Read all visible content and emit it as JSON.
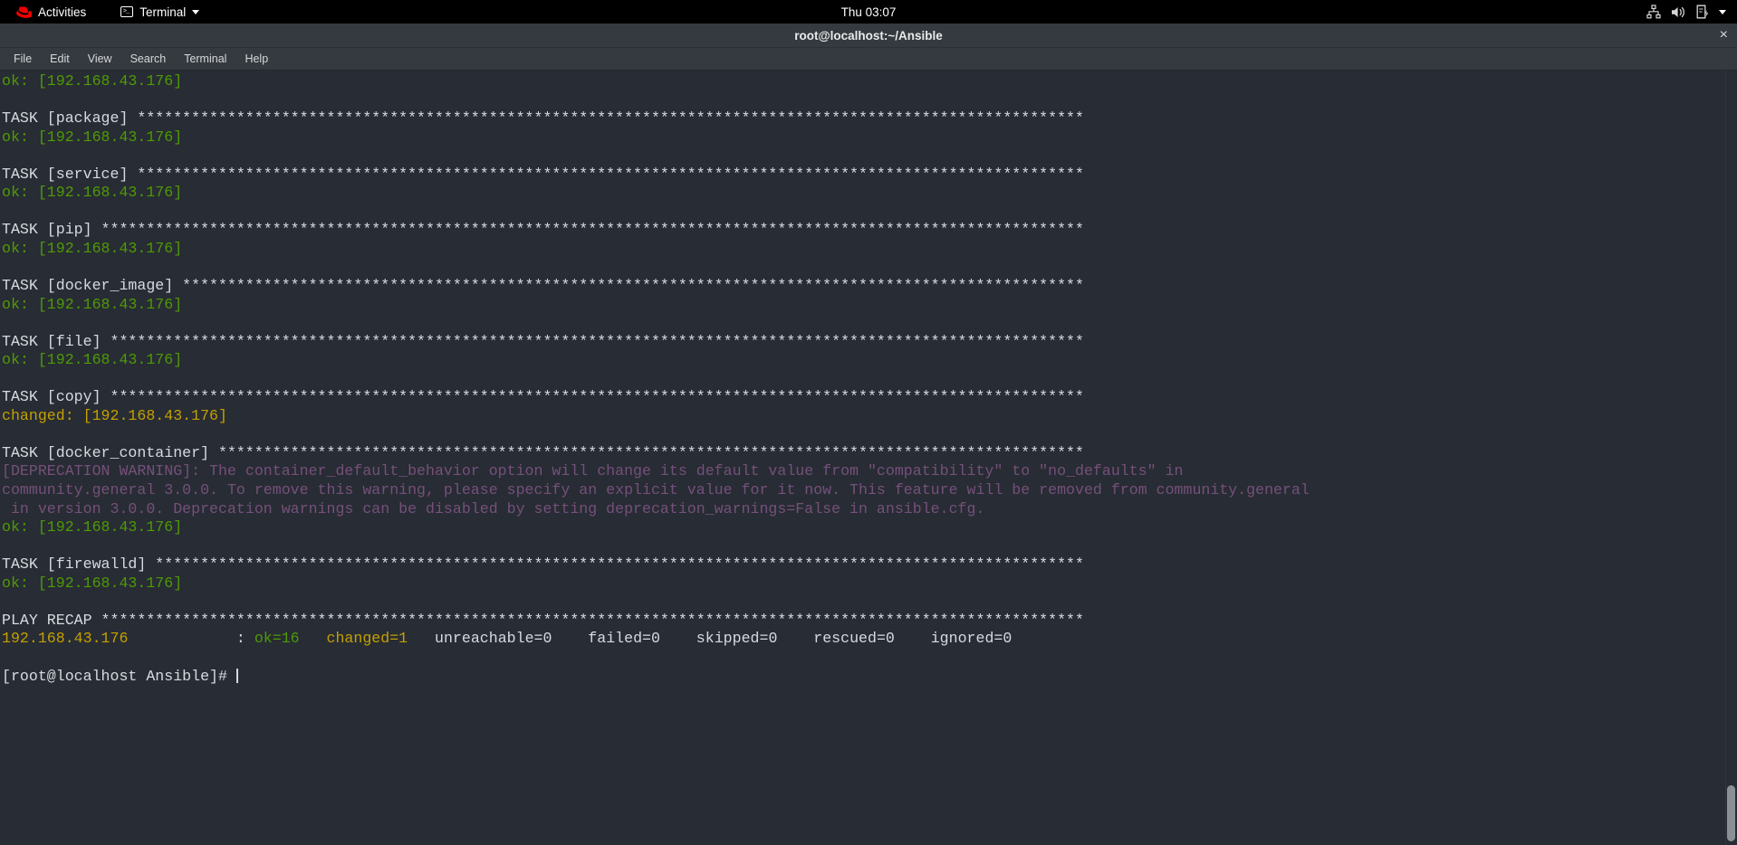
{
  "topbar": {
    "activities_label": "Activities",
    "app_label": "Terminal",
    "clock": "Thu 03:07",
    "icons": {
      "redhat": "redhat-logo-icon",
      "terminal": "terminal-icon",
      "caret": "chevron-down-icon",
      "network": "network-icon",
      "volume": "volume-icon",
      "battery": "battery-charging-icon",
      "system_menu_caret": "chevron-down-icon"
    }
  },
  "window": {
    "title": "root@localhost:~/Ansible",
    "close_glyph": "×"
  },
  "menubar": {
    "items": [
      {
        "label": "File"
      },
      {
        "label": "Edit"
      },
      {
        "label": "View"
      },
      {
        "label": "Search"
      },
      {
        "label": "Terminal"
      },
      {
        "label": "Help"
      }
    ]
  },
  "terminal": {
    "host": "192.168.43.176",
    "prompt": "[root@localhost Ansible]# ",
    "lines": [
      {
        "text": "ok: [192.168.43.176]",
        "color": "green"
      },
      {
        "text": "",
        "color": "white"
      },
      {
        "text": "TASK [package] *********************************************************************************************************",
        "color": "white"
      },
      {
        "text": "ok: [192.168.43.176]",
        "color": "green"
      },
      {
        "text": "",
        "color": "white"
      },
      {
        "text": "TASK [service] *********************************************************************************************************",
        "color": "white"
      },
      {
        "text": "ok: [192.168.43.176]",
        "color": "green"
      },
      {
        "text": "",
        "color": "white"
      },
      {
        "text": "TASK [pip] *************************************************************************************************************",
        "color": "white"
      },
      {
        "text": "ok: [192.168.43.176]",
        "color": "green"
      },
      {
        "text": "",
        "color": "white"
      },
      {
        "text": "TASK [docker_image] ****************************************************************************************************",
        "color": "white"
      },
      {
        "text": "ok: [192.168.43.176]",
        "color": "green"
      },
      {
        "text": "",
        "color": "white"
      },
      {
        "text": "TASK [file] ************************************************************************************************************",
        "color": "white"
      },
      {
        "text": "ok: [192.168.43.176]",
        "color": "green"
      },
      {
        "text": "",
        "color": "white"
      },
      {
        "text": "TASK [copy] ************************************************************************************************************",
        "color": "white"
      },
      {
        "text": "changed: [192.168.43.176]",
        "color": "yellow"
      },
      {
        "text": "",
        "color": "white"
      },
      {
        "text": "TASK [docker_container] ************************************************************************************************",
        "color": "white"
      },
      {
        "text": "[DEPRECATION WARNING]: The container_default_behavior option will change its default value from \"compatibility\" to \"no_defaults\" in",
        "color": "purple"
      },
      {
        "text": "community.general 3.0.0. To remove this warning, please specify an explicit value for it now. This feature will be removed from community.general",
        "color": "purple"
      },
      {
        "text": " in version 3.0.0. Deprecation warnings can be disabled by setting deprecation_warnings=False in ansible.cfg.",
        "color": "purple"
      },
      {
        "text": "ok: [192.168.43.176]",
        "color": "green"
      },
      {
        "text": "",
        "color": "white"
      },
      {
        "text": "TASK [firewalld] *******************************************************************************************************",
        "color": "white"
      },
      {
        "text": "ok: [192.168.43.176]",
        "color": "green"
      },
      {
        "text": "",
        "color": "white"
      },
      {
        "text": "PLAY RECAP *************************************************************************************************************",
        "color": "white"
      }
    ],
    "recap": {
      "host": "192.168.43.176",
      "pad": "            ",
      "colon": ": ",
      "ok": "ok=16",
      "changed": "changed=1",
      "rest": "   unreachable=0    failed=0    skipped=0    rescued=0    ignored=0"
    }
  }
}
